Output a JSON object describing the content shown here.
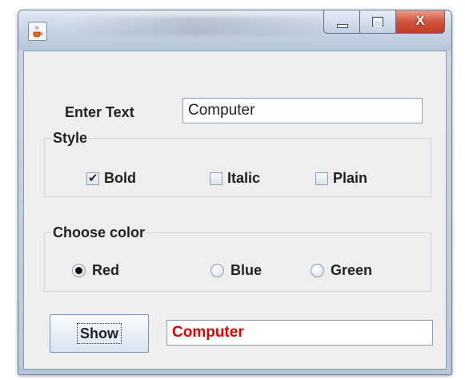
{
  "window": {
    "title": "",
    "controls": {
      "minimize_icon": "minimize-icon",
      "maximize_icon": "maximize-icon",
      "close_glyph": "X"
    }
  },
  "form": {
    "enter_text_label": "Enter Text",
    "input_value": "Computer"
  },
  "style_group": {
    "title": "Style",
    "options": [
      {
        "label": "Bold",
        "checked": true
      },
      {
        "label": "Italic",
        "checked": false
      },
      {
        "label": "Plain",
        "checked": false
      }
    ]
  },
  "color_group": {
    "title": "Choose color",
    "options": [
      {
        "label": "Red",
        "selected": true
      },
      {
        "label": "Blue",
        "selected": false
      },
      {
        "label": "Green",
        "selected": false
      }
    ]
  },
  "actions": {
    "show_label": "Show",
    "output_value": "Computer",
    "output_color": "#e00000"
  }
}
